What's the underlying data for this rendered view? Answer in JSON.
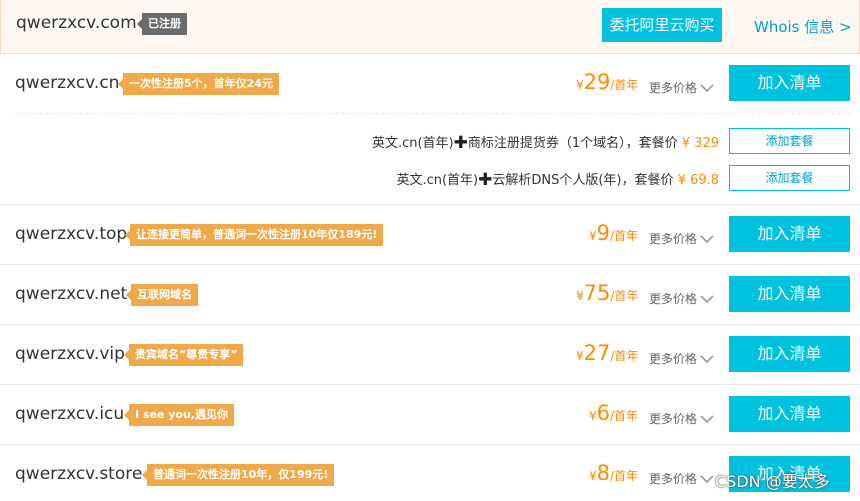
{
  "header": {
    "domain": "qwerzxcv.com",
    "status_badge": "已注册",
    "delegate_button": "委托阿里云购买",
    "whois_link": "Whois 信息 >"
  },
  "common": {
    "currency": "¥",
    "per_year": "/首年",
    "more_price": "更多价格",
    "add_to_list": "加入清单"
  },
  "rows": [
    {
      "domain": "qwerzxcv.cn",
      "promo": "一次性注册5个，首年仅24元",
      "price": "29"
    },
    {
      "domain": "qwerzxcv.top",
      "promo": "让连接更简单，普通词一次性注册10年仅189元!",
      "price": "9"
    },
    {
      "domain": "qwerzxcv.net",
      "promo": "互联网域名",
      "price": "75"
    },
    {
      "domain": "qwerzxcv.vip",
      "promo": "贵宾域名“尊贵专享”",
      "price": "27"
    },
    {
      "domain": "qwerzxcv.icu",
      "promo": "I see you,遇见你",
      "price": "6"
    },
    {
      "domain": "qwerzxcv.store",
      "promo": "普通词一次性注册10年，仅199元!",
      "price": "8"
    }
  ],
  "bundles": [
    {
      "prefix": "英文.cn(首年)",
      "suffix": "商标注册提货券（1个域名），套餐价",
      "price": "¥ 329",
      "button": "添加套餐"
    },
    {
      "prefix": "英文.cn(首年)",
      "suffix": "云解析DNS个人版(年)，套餐价",
      "price": "¥ 69.8",
      "button": "添加套餐"
    }
  ],
  "watermark": "CSDN @要太多"
}
